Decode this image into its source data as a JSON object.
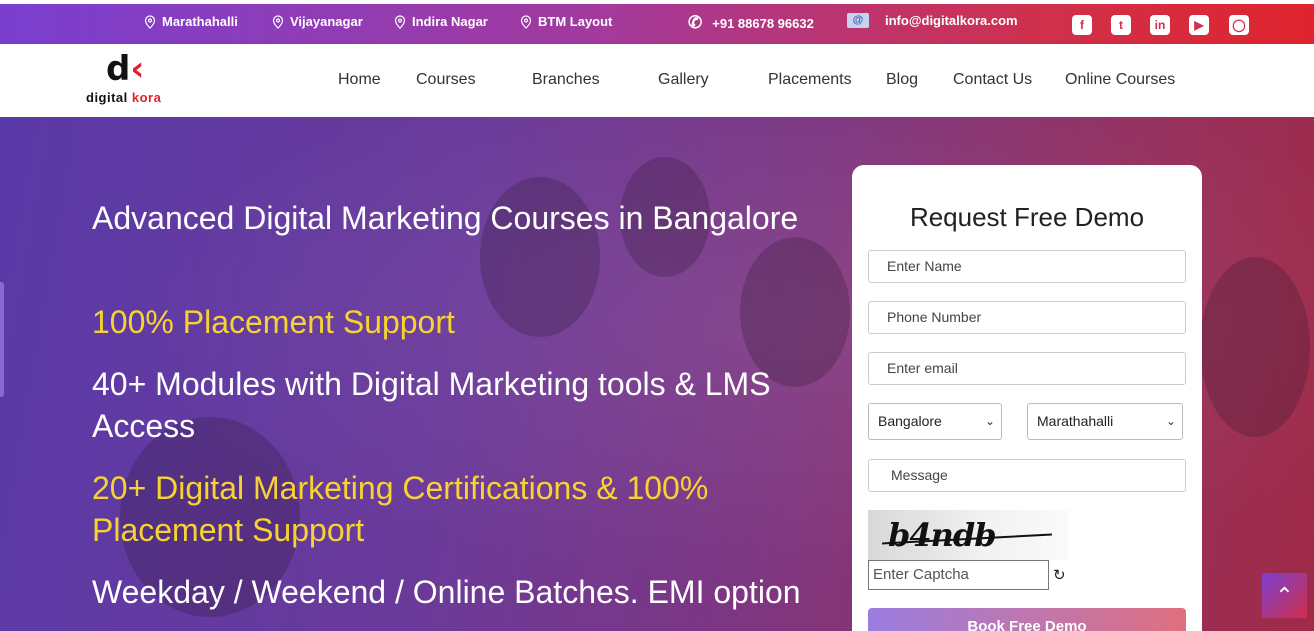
{
  "topbar": {
    "locations": [
      "Marathahalli",
      "Vijayanagar",
      "Indira Nagar",
      "BTM Layout"
    ],
    "phone": "+91 88678 96632",
    "email": "info@digitalkora.com",
    "social": [
      "facebook-icon",
      "twitter-icon",
      "linkedin-icon",
      "youtube-icon",
      "instagram-icon"
    ]
  },
  "logo": {
    "text_a": "digital ",
    "text_b": "kora"
  },
  "nav": {
    "items": [
      "Home",
      "Courses",
      "Branches",
      "Gallery",
      "Placements",
      "Blog",
      "Contact Us",
      "Online Courses"
    ]
  },
  "hero": {
    "line1": "Advanced Digital Marketing Courses in Bangalore",
    "line2": "100% Placement Support",
    "line3": "40+ Modules with Digital Marketing tools & LMS Access",
    "line4": "20+ Digital Marketing Certifications & 100% Placement Support",
    "line5": "Weekday / Weekend / Online Batches. EMI option"
  },
  "form": {
    "title": "Request Free Demo",
    "name_placeholder": "Enter Name",
    "phone_placeholder": "Phone Number",
    "email_placeholder": "Enter email",
    "city_selected": "Bangalore",
    "branch_selected": "Marathahalli",
    "message_placeholder": "Message",
    "captcha_text": "b4ndb",
    "captcha_placeholder": "Enter Captcha",
    "submit_label": "Book Free Demo"
  },
  "colors": {
    "accent_yellow": "#f7d331",
    "brand_red": "#e02030",
    "gradient_start": "#7a3fd0",
    "gradient_end": "#e0242e"
  }
}
